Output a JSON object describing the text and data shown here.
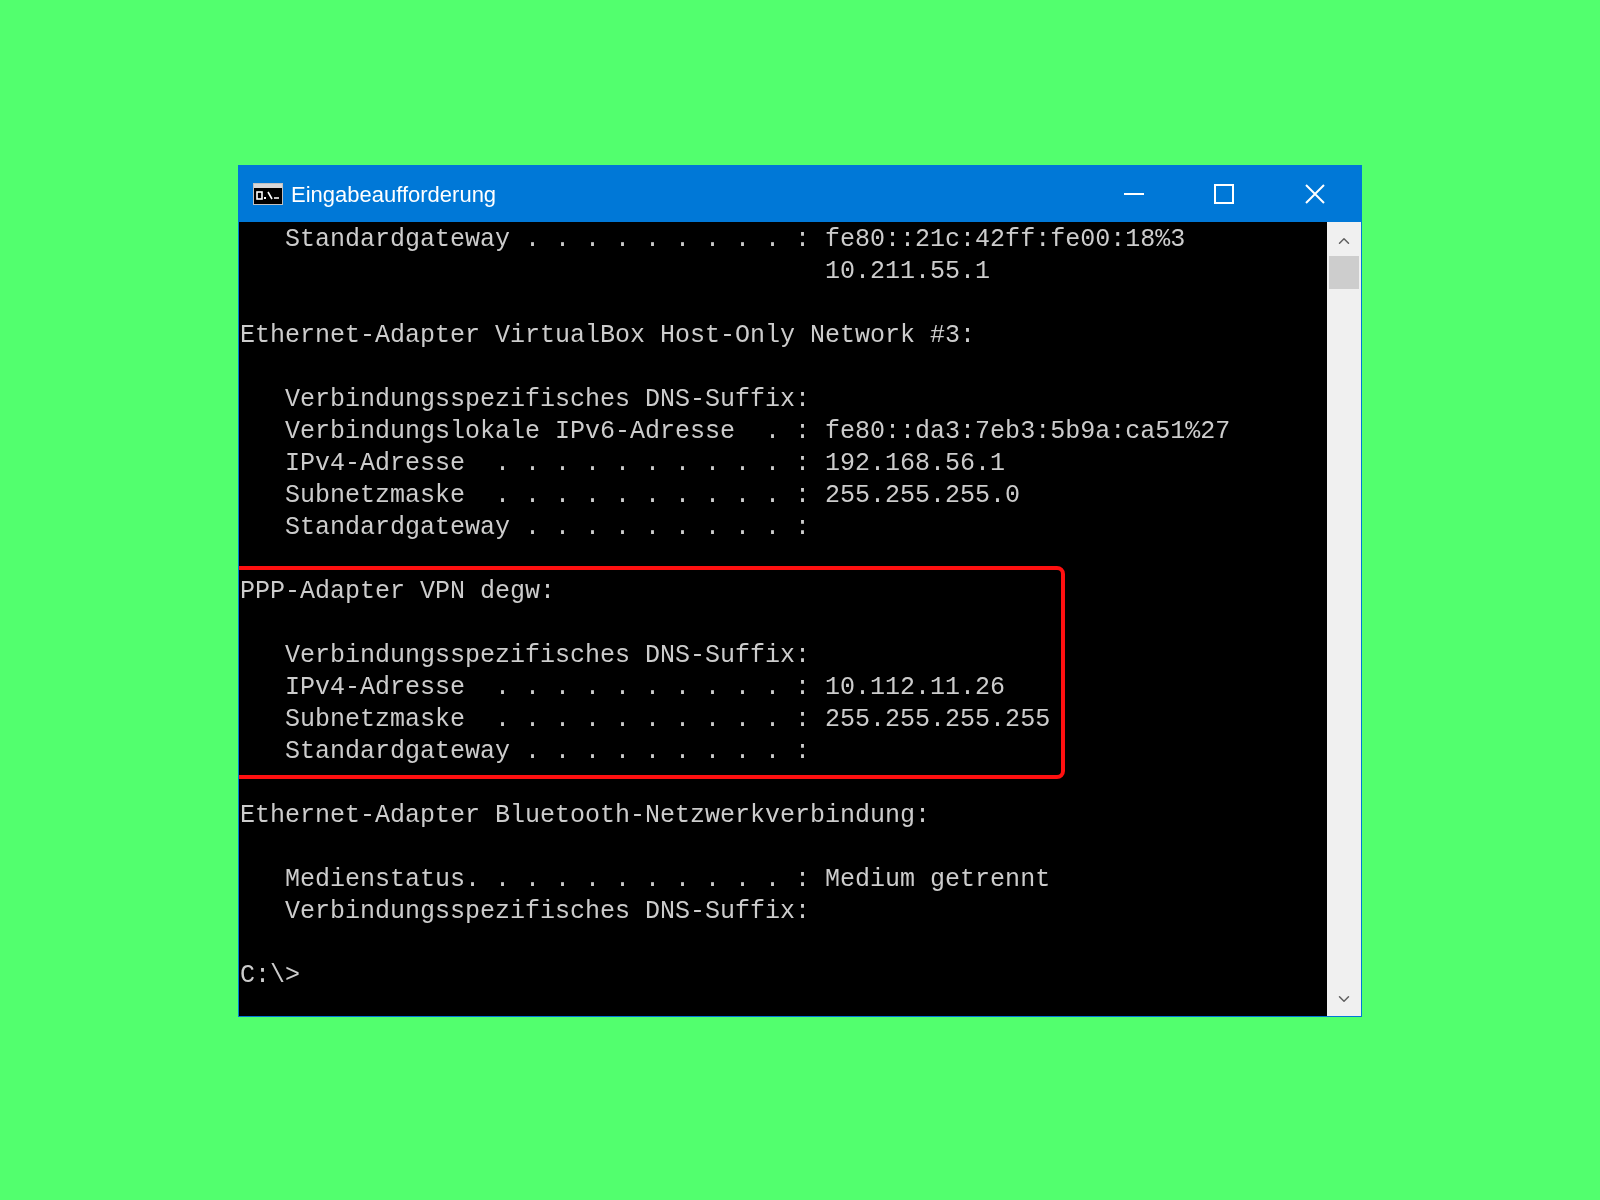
{
  "window": {
    "title": "Eingabeaufforderung"
  },
  "console": {
    "sections": [
      {
        "highlighted": false,
        "groups": [
          [
            "   Standardgateway . . . . . . . . . : fe80::21c:42ff:fe00:18%3",
            "                                       10.211.55.1"
          ]
        ]
      },
      {
        "highlighted": false,
        "groups": [
          [
            "Ethernet-Adapter VirtualBox Host-Only Network #3:"
          ],
          [
            "   Verbindungsspezifisches DNS-Suffix:",
            "   Verbindungslokale IPv6-Adresse  . : fe80::da3:7eb3:5b9a:ca51%27",
            "   IPv4-Adresse  . . . . . . . . . . : 192.168.56.1",
            "   Subnetzmaske  . . . . . . . . . . : 255.255.255.0",
            "   Standardgateway . . . . . . . . . :"
          ]
        ]
      },
      {
        "highlighted": true,
        "groups": [
          [
            "PPP-Adapter VPN degw:"
          ],
          [
            "   Verbindungsspezifisches DNS-Suffix:",
            "   IPv4-Adresse  . . . . . . . . . . : 10.112.11.26",
            "   Subnetzmaske  . . . . . . . . . . : 255.255.255.255",
            "   Standardgateway . . . . . . . . . :"
          ]
        ]
      },
      {
        "highlighted": false,
        "groups": [
          [
            "Ethernet-Adapter Bluetooth-Netzwerkverbindung:"
          ],
          [
            "   Medienstatus. . . . . . . . . . . : Medium getrennt",
            "   Verbindungsspezifisches DNS-Suffix:"
          ]
        ]
      },
      {
        "highlighted": false,
        "groups": [
          [
            "C:\\>"
          ]
        ]
      }
    ]
  }
}
